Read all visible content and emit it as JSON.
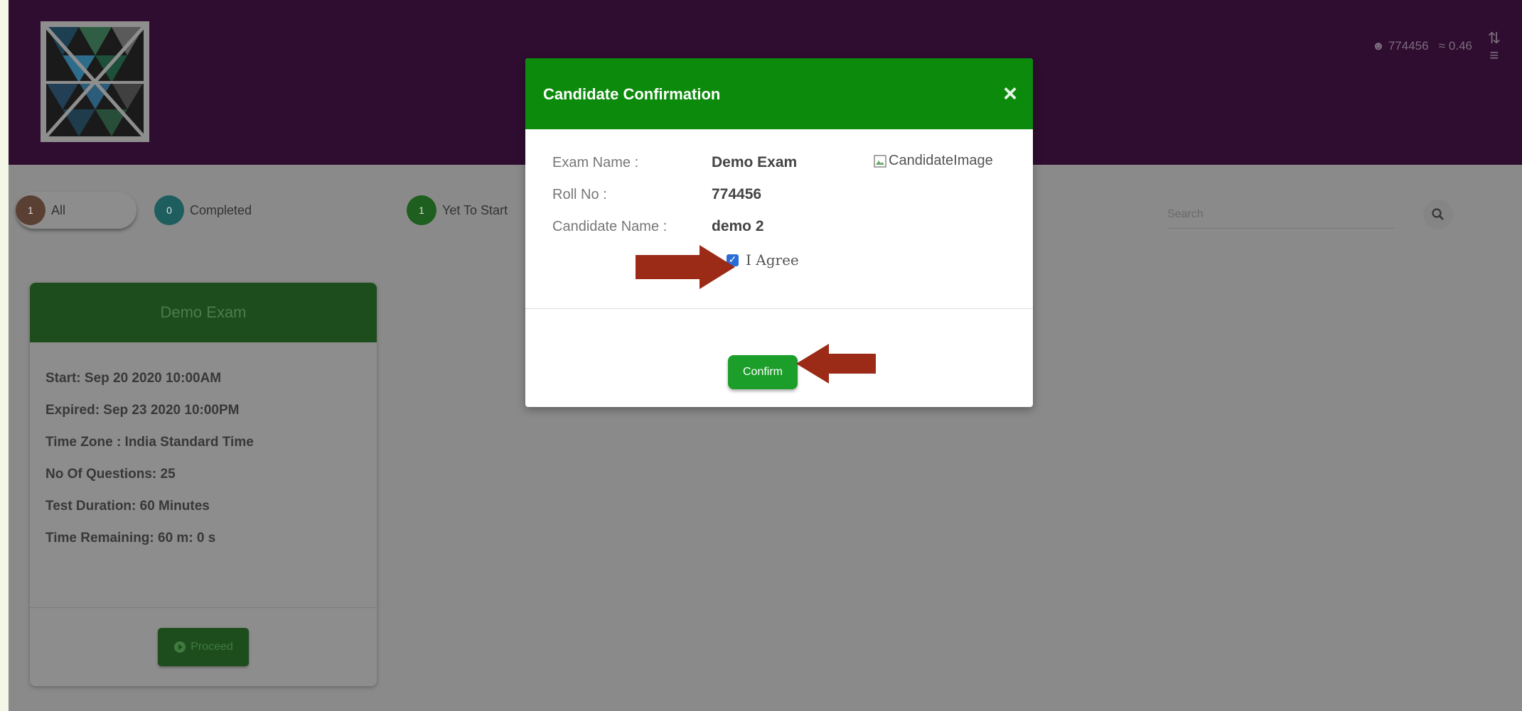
{
  "header": {
    "user_id": "774456",
    "signal": "0.46"
  },
  "filters": {
    "all": {
      "count": "1",
      "label": "All"
    },
    "completed": {
      "count": "0",
      "label": "Completed"
    },
    "yet_to_start": {
      "count": "1",
      "label": "Yet To Start"
    },
    "search_placeholder": "Search"
  },
  "exam_card": {
    "title": "Demo Exam",
    "start": "Start: Sep 20 2020 10:00AM",
    "expired": "Expired: Sep 23 2020 10:00PM",
    "time_zone": "Time Zone : India Standard Time",
    "questions": "No Of Questions: 25",
    "duration": "Test Duration: 60 Minutes",
    "remaining": "Time Remaining: 60 m: 0 s",
    "proceed_label": "Proceed"
  },
  "modal": {
    "title": "Candidate Confirmation",
    "close": "×",
    "exam_name_label": "Exam Name :",
    "exam_name": "Demo Exam",
    "roll_no_label": "Roll No :",
    "roll_no": "774456",
    "candidate_name_label": "Candidate Name :",
    "candidate_name": "demo 2",
    "candidate_image_alt": "CandidateImage",
    "agree_label": "I Agree",
    "agree_checked": true,
    "confirm_label": "Confirm"
  },
  "colors": {
    "header_bg": "#2f0d30",
    "modal_header": "#0c8a0c",
    "confirm_button": "#1b9e2a",
    "arrow": "#9b2a17"
  }
}
